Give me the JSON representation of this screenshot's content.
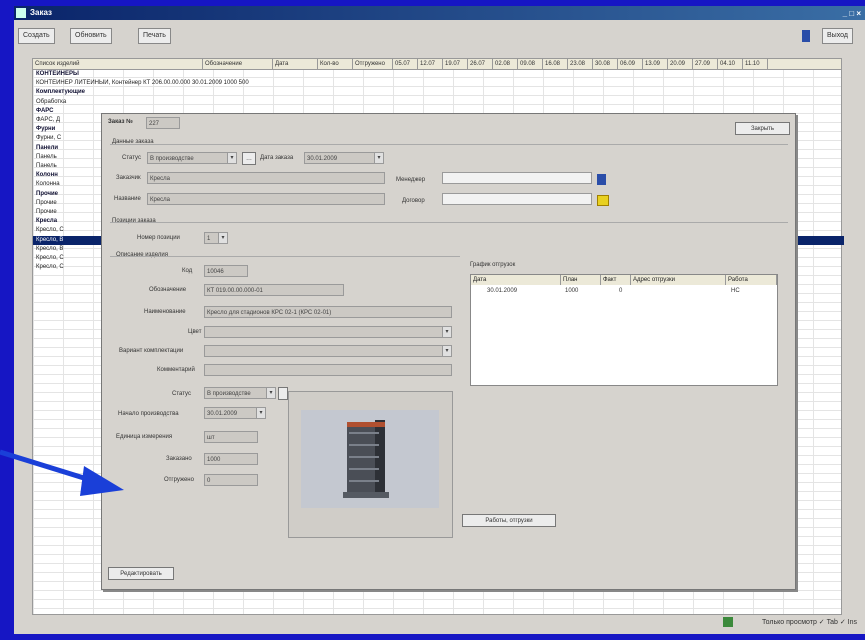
{
  "window": {
    "title": "Заказ",
    "controls": "_ □ ×"
  },
  "toolbar": {
    "btn1": "Создать",
    "btn2": "Обновить",
    "btn3": "Печать",
    "right_btn": "Выход"
  },
  "grid": {
    "headers": [
      "Список изделий",
      "Обозначение",
      "Дата",
      "Кол-во",
      "Отгружено",
      "05.07",
      "12.07",
      "19.07",
      "26.07",
      "02.08",
      "09.08",
      "16.08",
      "23.08",
      "30.08",
      "06.09",
      "13.09",
      "20.09",
      "27.09",
      "04.10",
      "11.10"
    ],
    "rows": [
      {
        "text": "КОНТЕЙНЕРЫ",
        "grp": true
      },
      {
        "text": "КОНТЕЙНЕР ЛИТЕЙНЫЙ, Контейнер     КТ 206.00.00.000   30.01.2009      1000       500",
        "grp": false
      },
      {
        "text": "Комплектующие",
        "grp": true
      },
      {
        "text": "Обработка",
        "grp": false
      },
      {
        "text": "ФАРС",
        "grp": true
      },
      {
        "text": "ФАРС, Д",
        "grp": false
      },
      {
        "text": "Фурни",
        "grp": true
      },
      {
        "text": "Фурни, С",
        "grp": false
      },
      {
        "text": "Панели",
        "grp": true
      },
      {
        "text": "Панель",
        "grp": false
      },
      {
        "text": "Панель",
        "grp": false
      },
      {
        "text": "Колонн",
        "grp": true
      },
      {
        "text": "Колонна",
        "grp": false
      },
      {
        "text": "Прочие",
        "grp": true
      },
      {
        "text": "Прочие",
        "grp": false
      },
      {
        "text": "Прочие",
        "grp": false
      },
      {
        "text": "Кресла",
        "grp": true
      },
      {
        "text": "Кресло, С",
        "grp": false
      },
      {
        "text": "Кресло, В",
        "grp": false,
        "sel": true
      },
      {
        "text": "Кресло, В",
        "grp": false
      },
      {
        "text": "Кресло, С",
        "grp": false
      },
      {
        "text": "Кресло, С",
        "grp": false
      }
    ]
  },
  "dialog": {
    "order_label": "Заказ №",
    "order_no": "227",
    "close_btn": "Закрыть",
    "section_general": "Данные заказа",
    "status_label": "Статус",
    "status_value": "В производстве",
    "date_label": "Дата заказа",
    "date_value": "30.01.2009",
    "customer_label": "Заказчик",
    "customer_value": "Кресла",
    "name_label": "Название",
    "name_value": "Кресла",
    "manager_label": "Менеджер",
    "manager_value": "",
    "contract_label": "Договор",
    "contract_value": "",
    "section_items": "Позиции заказа",
    "pos_label": "Номер позиции",
    "pos_value": "1",
    "section_item": "Описание изделия",
    "code_label": "Код",
    "code_value": "10046",
    "designation_label": "Обозначение",
    "designation_value": "КТ 019.00.00.000-01",
    "name2_label": "Наименование",
    "name2_value": "Кресло для стадионов КРС 02-1 (КРС 02-01)",
    "color_label": "Цвет",
    "color_value": "",
    "config_label": "Вариант комплектации",
    "config_value": "",
    "comment_label": "Комментарий",
    "comment_value": "",
    "state_label": "Статус",
    "state_value": "В производстве",
    "start_label": "Начало производства",
    "start_value": "30.01.2009",
    "unit_label": "Единица измерения",
    "unit_value": "шт",
    "qty_label": "Заказано",
    "qty_value": "1000",
    "shipped_label": "Отгружено",
    "shipped_value": "0",
    "schedule_title": "График отгрузок",
    "schedule_headers": [
      "Дата",
      "План",
      "Факт",
      "Адрес отгрузки",
      "Работа"
    ],
    "schedule_row": [
      "30.01.2009",
      "1000",
      "0",
      "",
      "НС"
    ],
    "shipping_btn": "Работы, отгрузки",
    "bottom_btn": "Редактировать"
  },
  "statusbar": {
    "text": "Только просмотр ✓ Tab ✓ Ins"
  },
  "colors": {
    "desktop": "#1616c4",
    "arrow": "#1a3fd8"
  }
}
